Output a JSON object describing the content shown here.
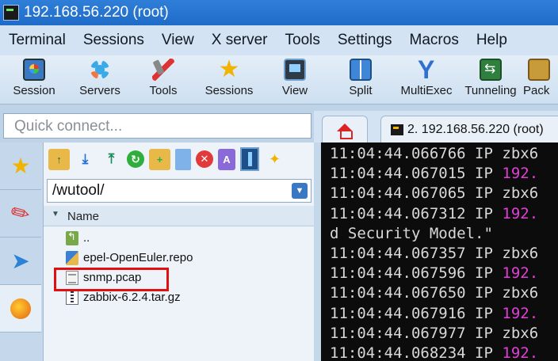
{
  "window": {
    "title": "192.168.56.220 (root)"
  },
  "menu": [
    "Terminal",
    "Sessions",
    "View",
    "X server",
    "Tools",
    "Settings",
    "Macros",
    "Help"
  ],
  "toolbar": [
    {
      "label": "Session",
      "icon": "session-icon"
    },
    {
      "label": "Servers",
      "icon": "servers-icon"
    },
    {
      "label": "Tools",
      "icon": "tools-icon"
    },
    {
      "label": "Sessions",
      "icon": "star-icon"
    },
    {
      "label": "View",
      "icon": "view-icon"
    },
    {
      "label": "Split",
      "icon": "split-icon"
    },
    {
      "label": "MultiExec",
      "icon": "multiexec-icon"
    },
    {
      "label": "Tunneling",
      "icon": "tunneling-icon"
    },
    {
      "label": "Pack",
      "icon": "packages-icon"
    }
  ],
  "quick_connect": {
    "placeholder": "Quick connect..."
  },
  "sidetabs": [
    "star-icon",
    "tools-icon",
    "send-icon",
    "globe-icon"
  ],
  "sftp": {
    "path": "/wutool/",
    "column": "Name",
    "files": [
      {
        "name": "..",
        "icon": "parent-folder-icon"
      },
      {
        "name": "epel-OpenEuler.repo",
        "icon": "repo-file-icon"
      },
      {
        "name": "snmp.pcap",
        "icon": "pcap-file-icon"
      },
      {
        "name": "zabbix-6.2.4.tar.gz",
        "icon": "archive-file-icon"
      }
    ]
  },
  "tabs": {
    "session_tab": "2. 192.168.56.220 (root)"
  },
  "terminal": {
    "lines": [
      {
        "ts": "11:04:44.066766",
        "proto": "IP",
        "host": "zbx6",
        "kind": "host"
      },
      {
        "ts": "11:04:44.067015",
        "proto": "IP",
        "host": "192.",
        "kind": "ip"
      },
      {
        "ts": "11:04:44.067065",
        "proto": "IP",
        "host": "zbx6",
        "kind": "host"
      },
      {
        "ts": "11:04:44.067312",
        "proto": "IP",
        "host": "192.",
        "kind": "ip"
      },
      {
        "text": "d Security Model.\"",
        "kind": "text"
      },
      {
        "ts": "11:04:44.067357",
        "proto": "IP",
        "host": "zbx6",
        "kind": "host"
      },
      {
        "ts": "11:04:44.067596",
        "proto": "IP",
        "host": "192.",
        "kind": "ip"
      },
      {
        "ts": "11:04:44.067650",
        "proto": "IP",
        "host": "zbx6",
        "kind": "host"
      },
      {
        "ts": "11:04:44.067916",
        "proto": "IP",
        "host": "192.",
        "kind": "ip"
      },
      {
        "ts": "11:04:44.067977",
        "proto": "IP",
        "host": "zbx6",
        "kind": "host"
      },
      {
        "ts": "11:04:44.068234",
        "proto": "IP",
        "host": "192.",
        "kind": "ip"
      }
    ]
  },
  "colors": {
    "titlebar": "#2f7ed8",
    "ip_highlight": "#e23ed8",
    "terminal_bg": "#0c0c0c",
    "selection_box": "#e01010"
  }
}
